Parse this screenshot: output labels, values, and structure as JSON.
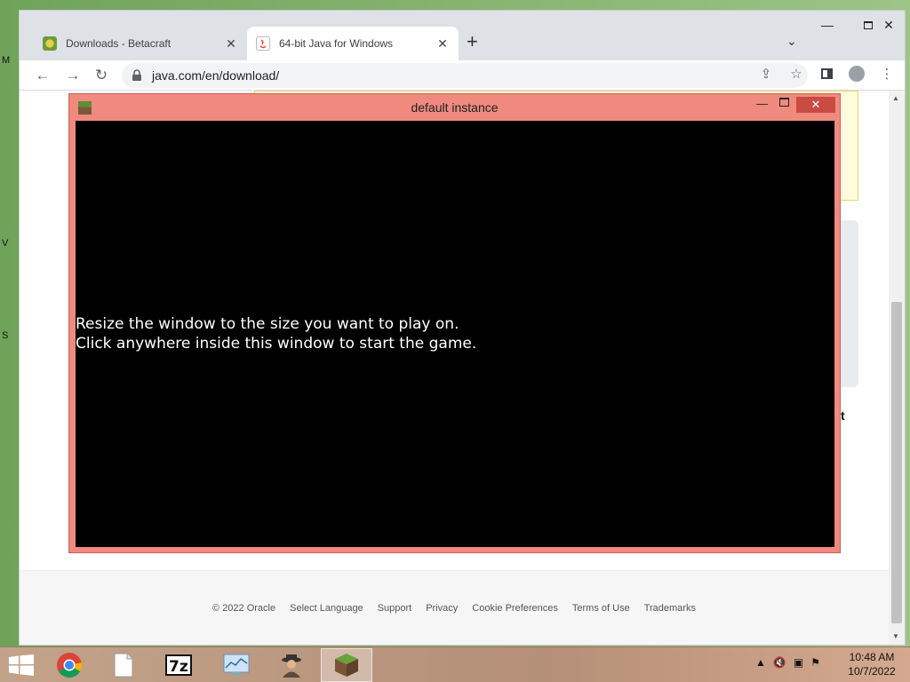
{
  "browser": {
    "tabs": [
      {
        "title": "Downloads - Betacraft",
        "active": false
      },
      {
        "title": "64-bit Java for Windows",
        "active": true
      }
    ],
    "url": "java.com/en/download/"
  },
  "game_window": {
    "title": "default instance",
    "message_line1": "Resize the window to the size you want to play on.",
    "message_line2": "Click anywhere inside this window to start the game."
  },
  "page": {
    "stray_text": "t",
    "footer_links": [
      "© 2022 Oracle",
      "Select Language",
      "Support",
      "Privacy",
      "Cookie Preferences",
      "Terms of Use",
      "Trademarks"
    ]
  },
  "taskbar": {
    "time": "10:48 AM",
    "date": "10/7/2022"
  },
  "colors": {
    "game_frame": "#f08a7f",
    "game_close": "#c94b41",
    "taskbar": "#b58f77"
  }
}
